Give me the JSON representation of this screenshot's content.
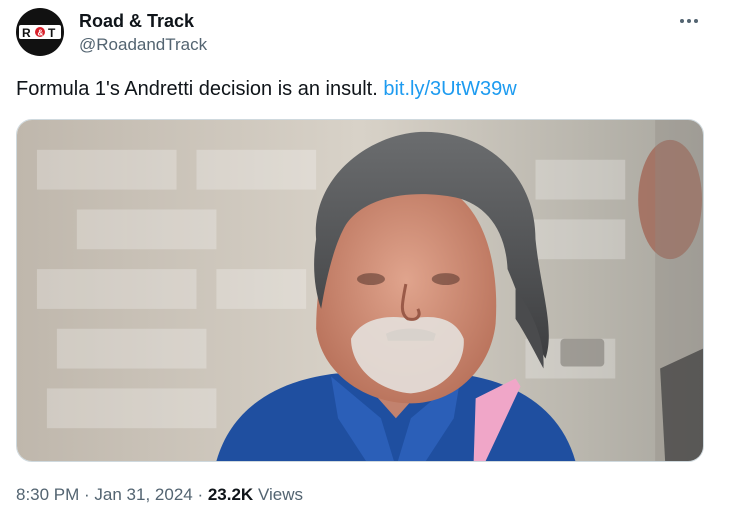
{
  "author": {
    "name": "Road & Track",
    "handle": "@RoadandTrack",
    "avatar_logo": "R&T"
  },
  "tweet": {
    "text": "Formula 1's Andretti decision is an insult. ",
    "link": "bit.ly/3UtW39w",
    "time": "8:30 PM",
    "date": "Jan 31, 2024",
    "separator": " · ",
    "views_count": "23.2K",
    "views_label": " Views"
  },
  "icons": {
    "more": "more-horizontal-icon"
  },
  "colors": {
    "link": "#1d9bf0",
    "secondary_text": "#536471",
    "primary_text": "#0f1419",
    "avatar_bg": "#111111",
    "logo_red": "#d8202a"
  }
}
